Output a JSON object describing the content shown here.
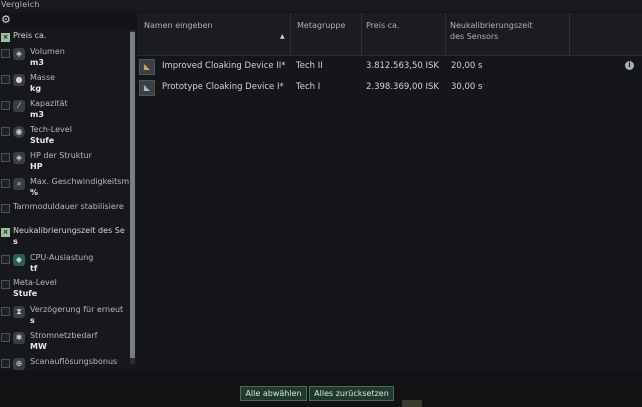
{
  "window": {
    "title": "Vergleich"
  },
  "left_panel": {
    "items": [
      {
        "label": "Preis ca.",
        "unit": "",
        "checked": true,
        "icon": ""
      },
      {
        "label": "Volumen",
        "unit": "m3",
        "checked": false,
        "icon": "cube-icon"
      },
      {
        "label": "Masse",
        "unit": "kg",
        "checked": false,
        "icon": "weight-icon"
      },
      {
        "label": "Kapazität",
        "unit": "m3",
        "checked": false,
        "icon": "capacity-icon"
      },
      {
        "label": "Tech-Level",
        "unit": "Stufe",
        "checked": false,
        "icon": "tech-level-icon"
      },
      {
        "label": "HP der Struktur",
        "unit": "HP",
        "checked": false,
        "icon": "structure-icon"
      },
      {
        "label": "Max. Geschwindigkeitsm",
        "unit": "%",
        "checked": false,
        "icon": "speed-icon"
      },
      {
        "label": "Tarnmoduldauer stabilisiere",
        "unit": "",
        "checked": false,
        "icon": ""
      },
      {
        "label": "Neukalibrierungszeit des Se",
        "unit": "s",
        "checked": true,
        "icon": ""
      },
      {
        "label": "CPU-Auslastung",
        "unit": "tf",
        "checked": false,
        "icon": "cpu-icon"
      },
      {
        "label": "Meta-Level",
        "unit": "Stufe",
        "checked": false,
        "icon": ""
      },
      {
        "label": "Verzögerung für erneut",
        "unit": "s",
        "checked": false,
        "icon": "hourglass-icon"
      },
      {
        "label": "Stromnetzbedarf",
        "unit": "MW",
        "checked": false,
        "icon": "power-icon"
      },
      {
        "label": "Scanauflösungsbonus",
        "unit": "",
        "checked": false,
        "icon": "scan-icon"
      }
    ]
  },
  "table": {
    "columns": [
      "Namen eingeben",
      "Metagruppe",
      "Preis ca.",
      "Neukalibrierungszeit des Sensors"
    ],
    "rows": [
      {
        "name": "Improved Cloaking Device II*",
        "meta": "Tech II",
        "price": "3.812.563,50 ISK",
        "recal": "20,00 s"
      },
      {
        "name": "Prototype Cloaking Device I*",
        "meta": "Tech I",
        "price": "2.398.369,00 ISK",
        "recal": "30,00 s"
      }
    ]
  },
  "buttons": {
    "select_all": "Alle abwählen",
    "reset_all": "Alles zurücksetzen"
  }
}
